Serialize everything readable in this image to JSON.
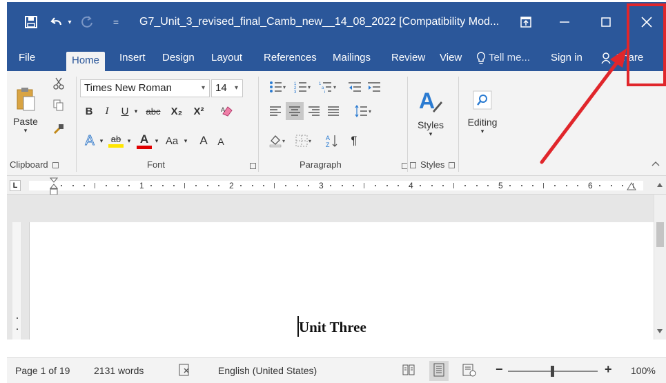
{
  "titlebar": {
    "document_title": "G7_Unit_3_revised_final_Camb_new__14_08_2022 [Compatibility Mod...",
    "icons": [
      "save-icon",
      "undo-icon",
      "redo-icon",
      "customize-quick-access-icon",
      "ribbon-display-options-icon",
      "minimize-icon",
      "maximize-icon",
      "close-icon"
    ],
    "undo_arrow": "▾",
    "customize_glyph": "="
  },
  "tabs": {
    "items": [
      "File",
      "Home",
      "Insert",
      "Design",
      "Layout",
      "References",
      "Mailings",
      "Review",
      "View"
    ],
    "active": "Home",
    "tell_me": "Tell me...",
    "sign_in": "Sign in",
    "share": "Share"
  },
  "ribbon": {
    "clipboard": {
      "paste": "Paste",
      "label": "Clipboard"
    },
    "font": {
      "name": "Times New Roman",
      "size": "14",
      "bold": "B",
      "italic": "I",
      "underline": "U",
      "strike": "abc",
      "subscript": "X₂",
      "superscript": "X²",
      "text_effects": "A",
      "highlight": "ab",
      "font_color": "A",
      "change_case": "Aa",
      "grow": "A",
      "shrink": "A",
      "label": "Font"
    },
    "paragraph": {
      "label": "Paragraph"
    },
    "styles": {
      "button": "Styles",
      "label": "Styles"
    },
    "editing": {
      "button": "Editing"
    }
  },
  "ruler": {
    "numbers": [
      "1",
      "2",
      "3",
      "4",
      "5",
      "6"
    ]
  },
  "document": {
    "text": "Unit Three"
  },
  "statusbar": {
    "page": "Page 1 of 19",
    "words": "2131 words",
    "language": "English (United States)",
    "zoom_minus": "−",
    "zoom_plus": "+",
    "zoom": "100%"
  },
  "colors": {
    "title_bar": "#2b579a",
    "ribbon_bg": "#f3f3f3",
    "annotation": "#e0262b",
    "highlight_yellow": "#ffe600",
    "font_color_red": "#e00000"
  }
}
